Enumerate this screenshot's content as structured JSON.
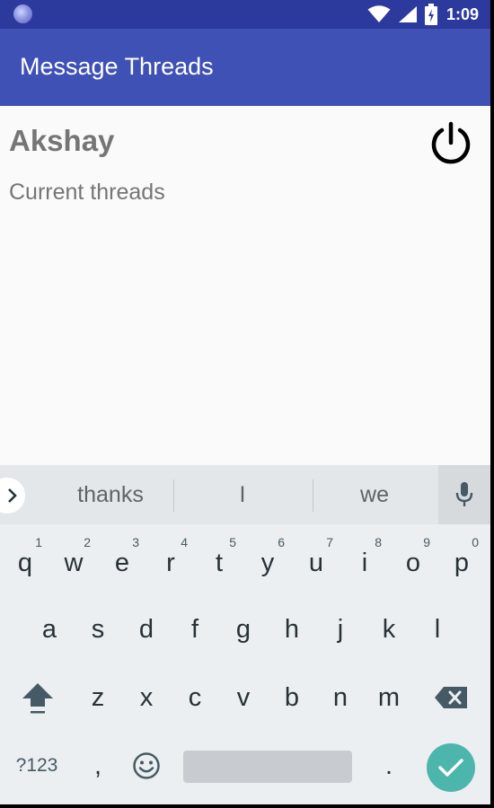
{
  "status_bar": {
    "time": "1:09"
  },
  "app_bar": {
    "title": "Message Threads"
  },
  "content": {
    "user_name": "Akshay",
    "section_label": "Current threads"
  },
  "keyboard": {
    "suggestions": [
      "thanks",
      "I",
      "we"
    ],
    "row1": [
      {
        "key": "q",
        "hint": "1"
      },
      {
        "key": "w",
        "hint": "2"
      },
      {
        "key": "e",
        "hint": "3"
      },
      {
        "key": "r",
        "hint": "4"
      },
      {
        "key": "t",
        "hint": "5"
      },
      {
        "key": "y",
        "hint": "6"
      },
      {
        "key": "u",
        "hint": "7"
      },
      {
        "key": "i",
        "hint": "8"
      },
      {
        "key": "o",
        "hint": "9"
      },
      {
        "key": "p",
        "hint": "0"
      }
    ],
    "row2": [
      "a",
      "s",
      "d",
      "f",
      "g",
      "h",
      "j",
      "k",
      "l"
    ],
    "row3": [
      "z",
      "x",
      "c",
      "v",
      "b",
      "n",
      "m"
    ],
    "symbols_label": "?123",
    "comma": ",",
    "period": ".",
    "icons": {
      "expand": "chevron-right-icon",
      "mic": "microphone-icon",
      "shift": "shift-icon",
      "backspace": "backspace-icon",
      "emoji": "emoji-icon",
      "enter": "checkmark-icon",
      "power": "power-icon"
    }
  },
  "colors": {
    "status_bar": "#2c3a9e",
    "app_bar": "#3f51b5",
    "content_bg": "#fafafa",
    "keyboard_bg": "#eceff1",
    "enter_accent": "#4db6ac"
  }
}
